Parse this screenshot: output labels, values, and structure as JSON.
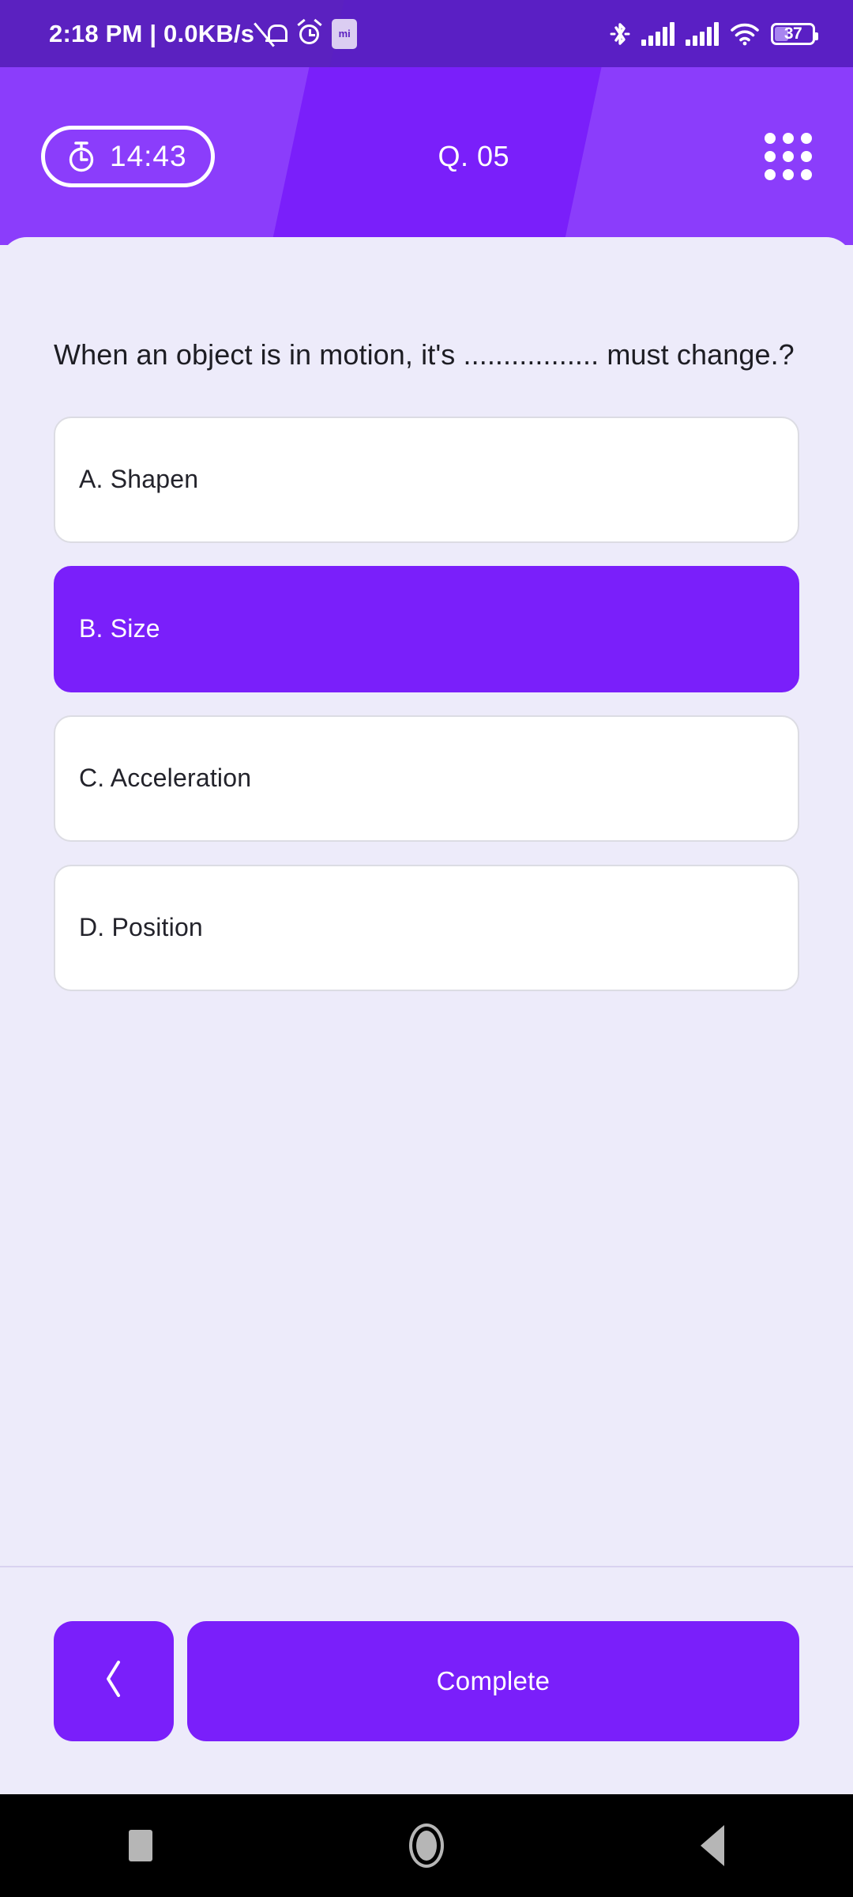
{
  "status_bar": {
    "time": "2:18 PM",
    "separator": "|",
    "network_speed": "0.0KB/s",
    "combined_text": "2:18 PM | 0.0KB/s",
    "icons": {
      "notifications_silenced": "bell-off-icon",
      "alarm": "alarm-icon",
      "mi_app": "mi-badge-icon",
      "bluetooth": "bluetooth-icon",
      "signal_sim1": "signal-bars-icon",
      "signal_sim2": "signal-bars-icon",
      "wifi": "wifi-icon",
      "battery": "battery-icon"
    },
    "battery_percent": "37",
    "signal_sim1_bars": 5,
    "signal_sim2_bars": 4,
    "wifi_bars": 3
  },
  "header": {
    "timer_label": "14:43",
    "timer_icon": "stopwatch-icon",
    "question_label": "Q. 05",
    "menu_icon": "grid-menu-icon"
  },
  "question": {
    "text": "When an object is in motion, it's ................. must change.?"
  },
  "options": [
    {
      "label": "A. Shapen",
      "selected": false
    },
    {
      "label": "B. Size",
      "selected": true
    },
    {
      "label": "C. Acceleration",
      "selected": false
    },
    {
      "label": "D. Position",
      "selected": false
    }
  ],
  "footer": {
    "back_icon": "chevron-left-icon",
    "complete_label": "Complete"
  },
  "android_nav": {
    "recents_icon": "square-recents-icon",
    "home_icon": "circle-home-icon",
    "back_icon": "triangle-back-icon"
  },
  "colors": {
    "brand_purple": "#7A1FFA",
    "header_light": "#8B3DFB",
    "status_bar": "#5B21C0",
    "page_bg": "#EDEBFA",
    "card_white": "#FFFFFF",
    "card_border": "#DCDCE3",
    "divider": "#D9D2F0",
    "nav_icon_gray": "#B6B6B6"
  }
}
